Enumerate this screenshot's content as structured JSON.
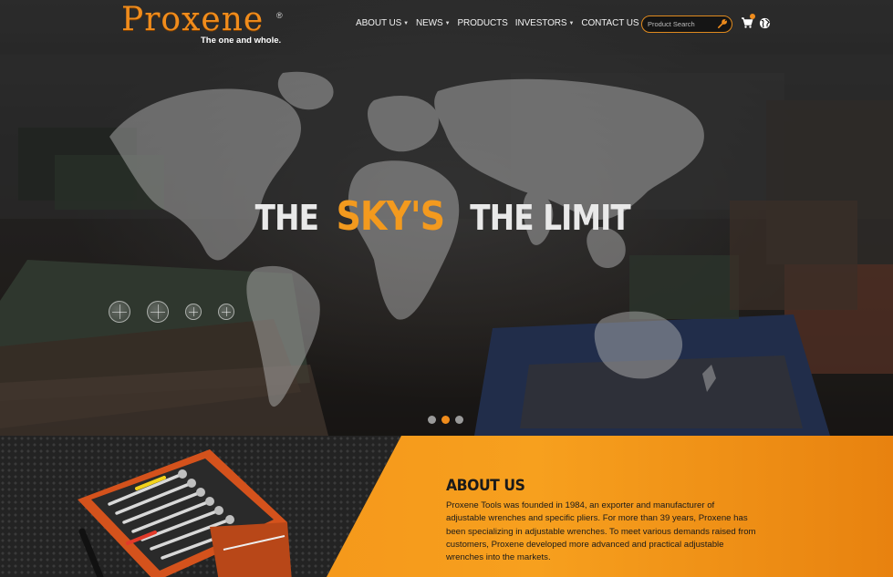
{
  "brand": {
    "name": "Proxene",
    "registered": "®",
    "tagline": "The one and whole."
  },
  "nav": [
    {
      "label": "ABOUT US",
      "has_dropdown": true
    },
    {
      "label": "NEWS",
      "has_dropdown": true
    },
    {
      "label": "PRODUCTS",
      "has_dropdown": false
    },
    {
      "label": "INVESTORS",
      "has_dropdown": true
    },
    {
      "label": "CONTACT US",
      "has_dropdown": false
    }
  ],
  "search": {
    "placeholder": "Product Search",
    "button_icon": "wrench-icon"
  },
  "icons": {
    "cart": "cart-icon",
    "language": "globe-icon"
  },
  "hero": {
    "headline_1": "THE",
    "headline_2": "SKY'S",
    "headline_3": "THE LIMIT",
    "slides_total": 3,
    "active_slide": 2
  },
  "about": {
    "title": "ABOUT US",
    "body": "Proxene Tools was founded in 1984, an exporter and manufacturer of adjustable wrenches and specific pliers. For more than 39 years, Proxene has been specializing in adjustable wrenches. To meet various demands raised from customers, Proxene developed more advanced and practical adjustable wrenches into the markets."
  },
  "colors": {
    "accent": "#f08c1c",
    "dark": "#232323",
    "text_light": "#f2f2f2"
  }
}
